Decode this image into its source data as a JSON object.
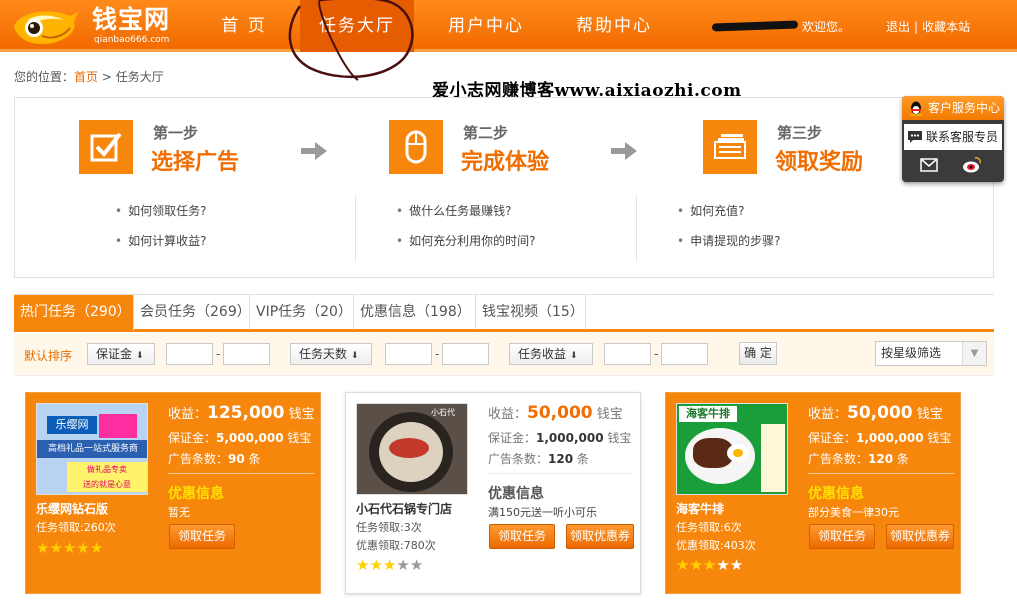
{
  "header": {
    "logo_cn": "钱宝网",
    "logo_en": "qianbao666.com",
    "nav": [
      "首 页",
      "任务大厅",
      "用户中心",
      "帮助中心"
    ],
    "welcome": "欢迎您。",
    "logout": "退出",
    "sep": "|",
    "favorite": "收藏本站",
    "colors": {
      "header": "#f26a00",
      "accent": "#f7860c"
    }
  },
  "breadcrumb": {
    "prefix": "您的位置：",
    "home": "首页",
    "sep": " > ",
    "current": "任务大厅"
  },
  "watermark": "爱小志网赚博客www.aixiaozhi.com",
  "steps": [
    {
      "num": "第一步",
      "title": "选择广告",
      "icon": "checkbox-icon"
    },
    {
      "num": "第二步",
      "title": "完成体验",
      "icon": "mouse-icon"
    },
    {
      "num": "第三步",
      "title": "领取奖励",
      "icon": "money-icon"
    }
  ],
  "questions": [
    [
      "如何领取任务?",
      "如何计算收益?"
    ],
    [
      "做什么任务最赚钱?",
      "如何充分利用你的时间?"
    ],
    [
      "如何充值?",
      "申请提现的步骤?"
    ]
  ],
  "service": {
    "title": "客户服务中心",
    "contact": "联系客服专员"
  },
  "tabs": [
    "热门任务（290）",
    "会员任务（269）",
    "VIP任务（20）",
    "优惠信息（198）",
    "钱宝视频（15）"
  ],
  "filter": {
    "label": "默认排序",
    "sort1": "保证金",
    "sort2": "任务天数",
    "sort3": "任务收益",
    "dash": "-",
    "ok": "确 定",
    "star_select": "按星级筛选"
  },
  "cards": [
    {
      "name": "乐缨网钻石版",
      "img_line1": "乐缨网",
      "img_line2": "高档礼品一站式服务商",
      "img_line3": "做礼品专卖",
      "img_line4": "送的就是心意",
      "receive": "任务领取:260次",
      "coupon": "",
      "stars": 5,
      "profit_label": "收益：",
      "profit": "125,000",
      "unit": "钱宝",
      "deposit_label": "保证金：",
      "deposit": "5,000,000",
      "ads_label": "广告条数：",
      "ads": "90",
      "ads_unit": "条",
      "promo_title": "优惠信息",
      "promo": "暂无",
      "btn_task": "领取任务",
      "btn_coupon": ""
    },
    {
      "name": "小石代石锅专门店",
      "img_line1": "小石代",
      "receive": "任务领取:3次",
      "coupon": "优惠领取:780次",
      "stars": 3,
      "profit_label": "收益：",
      "profit": "50,000",
      "unit": "钱宝",
      "deposit_label": "保证金：",
      "deposit": "1,000,000",
      "ads_label": "广告条数：",
      "ads": "120",
      "ads_unit": "条",
      "promo_title": "优惠信息",
      "promo": "满150元送一听小可乐",
      "btn_task": "领取任务",
      "btn_coupon": "领取优惠券"
    },
    {
      "name": "海客牛排",
      "img_line1": "海客牛排",
      "receive": "任务领取:6次",
      "coupon": "优惠领取:403次",
      "stars": 3,
      "profit_label": "收益：",
      "profit": "50,000",
      "unit": "钱宝",
      "deposit_label": "保证金：",
      "deposit": "1,000,000",
      "ads_label": "广告条数：",
      "ads": "120",
      "ads_unit": "条",
      "promo_title": "优惠信息",
      "promo": "部分美食一律30元",
      "btn_task": "领取任务",
      "btn_coupon": "领取优惠券"
    }
  ]
}
